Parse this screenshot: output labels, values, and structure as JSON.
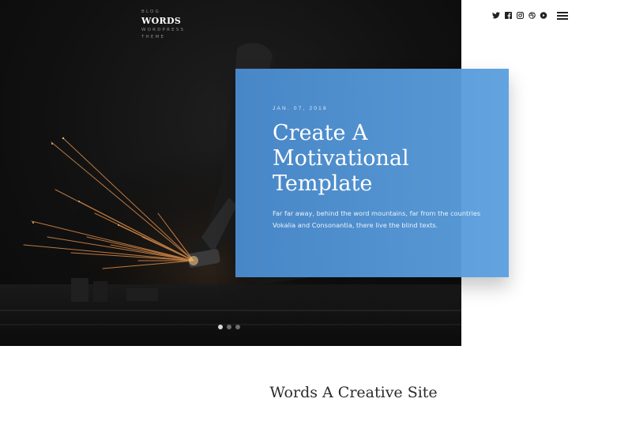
{
  "logo": {
    "top_label": "BLOG",
    "brand": "WORDS",
    "tagline_line1": "WORDPRESS",
    "tagline_line2": "THEME"
  },
  "hero": {
    "post_date": "JAN. 07, 2018",
    "post_title": "Create A Motivational Template",
    "post_excerpt": "Far far away, behind the word mountains, far from the countries Vokalia and Consonantia, there live the blind texts.",
    "slider": {
      "slide_count": 3,
      "active_index": 0
    }
  },
  "social": {
    "icons": [
      "twitter-icon",
      "facebook-icon",
      "instagram-icon",
      "dribbble-icon",
      "youtube-icon"
    ]
  },
  "menu": {
    "icon": "hamburger-menu-icon"
  },
  "section": {
    "title": "Words A Creative Site"
  },
  "colors": {
    "card_blue": "#4a8bce",
    "hero_dark": "#111111",
    "text_dark": "#2b2b2b",
    "white": "#ffffff"
  }
}
